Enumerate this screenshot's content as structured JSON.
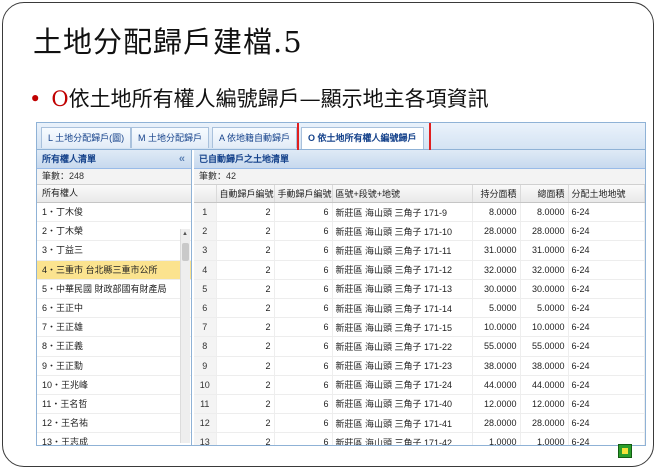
{
  "slide": {
    "title": "土地分配歸戶建檔.5",
    "bullet_key": "O",
    "bullet_text": "依土地所有權人編號歸戶—顯示地主各項資訊"
  },
  "tabs": [
    {
      "label": "L 土地分配歸戶(圖)",
      "active": false
    },
    {
      "label": "M 土地分配歸戶",
      "active": false
    },
    {
      "label": "A 依地籍自動歸戶",
      "active": false
    },
    {
      "label": "O 依土地所有權人編號歸戶",
      "active": true
    }
  ],
  "left_panel": {
    "title": "所有權人清單",
    "collapse_glyph": "«",
    "count": "筆數：248",
    "column": "所有權人",
    "owners": [
      "1・丁木俊",
      "2・丁木榮",
      "3・丁益三",
      "4・三重市 台北縣三重市公所",
      "5・中華民國 財政部國有財產局",
      "6・王正中",
      "7・王正雄",
      "8・王正義",
      "9・王正勳",
      "10・王兆峰",
      "11・王名哲",
      "12・王名祐",
      "13・王志成"
    ],
    "selected_index": 3
  },
  "right_panel": {
    "title": "已自動歸戶之土地清單",
    "count": "筆數：42",
    "columns": [
      "",
      "自動歸戶編號",
      "手動歸戶編號",
      "區號+段號+地號",
      "持分面積",
      "總面積",
      "分配土地地號"
    ],
    "rows": [
      [
        "1",
        "2",
        "6",
        "新莊區 海山頭 三角子 171-9",
        "8.0000",
        "8.0000",
        "6-24"
      ],
      [
        "2",
        "2",
        "6",
        "新莊區 海山頭 三角子 171-10",
        "28.0000",
        "28.0000",
        "6-24"
      ],
      [
        "3",
        "2",
        "6",
        "新莊區 海山頭 三角子 171-11",
        "31.0000",
        "31.0000",
        "6-24"
      ],
      [
        "4",
        "2",
        "6",
        "新莊區 海山頭 三角子 171-12",
        "32.0000",
        "32.0000",
        "6-24"
      ],
      [
        "5",
        "2",
        "6",
        "新莊區 海山頭 三角子 171-13",
        "30.0000",
        "30.0000",
        "6-24"
      ],
      [
        "6",
        "2",
        "6",
        "新莊區 海山頭 三角子 171-14",
        "5.0000",
        "5.0000",
        "6-24"
      ],
      [
        "7",
        "2",
        "6",
        "新莊區 海山頭 三角子 171-15",
        "10.0000",
        "10.0000",
        "6-24"
      ],
      [
        "8",
        "2",
        "6",
        "新莊區 海山頭 三角子 171-22",
        "55.0000",
        "55.0000",
        "6-24"
      ],
      [
        "9",
        "2",
        "6",
        "新莊區 海山頭 三角子 171-23",
        "38.0000",
        "38.0000",
        "6-24"
      ],
      [
        "10",
        "2",
        "6",
        "新莊區 海山頭 三角子 171-24",
        "44.0000",
        "44.0000",
        "6-24"
      ],
      [
        "11",
        "2",
        "6",
        "新莊區 海山頭 三角子 171-40",
        "12.0000",
        "12.0000",
        "6-24"
      ],
      [
        "12",
        "2",
        "6",
        "新莊區 海山頭 三角子 171-41",
        "28.0000",
        "28.0000",
        "6-24"
      ],
      [
        "13",
        "2",
        "6",
        "新莊區 海山頭 三角子 171-42",
        "1.0000",
        "1.0000",
        "6-24"
      ]
    ]
  },
  "colors": {
    "accent_red": "#c00000",
    "highlight_box": "#e01f1f",
    "selected_row": "#fbe38f",
    "panel_header": "#15428b"
  }
}
